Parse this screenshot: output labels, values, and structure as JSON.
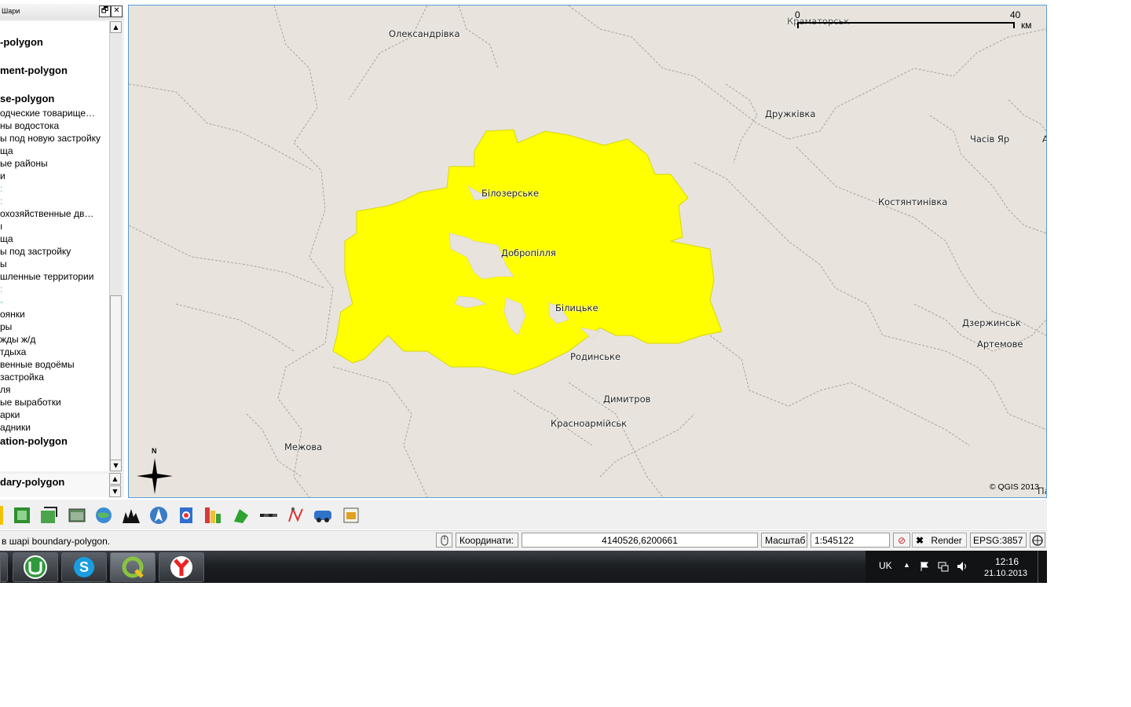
{
  "layers_panel": {
    "title": "Шари",
    "restore_glyph": "🗗",
    "close_glyph": "✕",
    "scroll_up": "▲",
    "scroll_down": "▼",
    "items": [
      {
        "label": "-polygon",
        "bold": true
      },
      {
        "label": "ment-polygon",
        "bold": true
      },
      {
        "label": "se-polygon",
        "bold": true
      },
      {
        "label": "одческие товарище…"
      },
      {
        "label": "ны водостока"
      },
      {
        "label": "ы под новую застройку"
      },
      {
        "label": "ща"
      },
      {
        "label": "ые районы"
      },
      {
        "label": "и"
      },
      {
        "label": ":",
        "cyan": true
      },
      {
        "label": ":",
        "cyan": true
      },
      {
        "label": "охозяйственные дв…"
      },
      {
        "label": "ı"
      },
      {
        "label": "ща"
      },
      {
        "label": "ы под застройку"
      },
      {
        "label": "ы"
      },
      {
        "label": "шленные территории"
      },
      {
        "label": ":",
        "cyan": true
      },
      {
        "label": "-",
        "cyan": true
      },
      {
        "label": "оянки"
      },
      {
        "label": "ры"
      },
      {
        "label": "жды ж/д"
      },
      {
        "label": "тдыха"
      },
      {
        "label": "венные водоёмы"
      },
      {
        "label": "застройка"
      },
      {
        "label": "ля"
      },
      {
        "label": "ые выработки"
      },
      {
        "label": "арки"
      },
      {
        "label": "адники"
      },
      {
        "label": "ation-polygon",
        "bold": true
      }
    ],
    "bottom_item": "dary-polygon"
  },
  "map": {
    "background_color": "#e8e4dd",
    "highlight_color": "#ffff00",
    "cities": [
      {
        "name": "Олександрівка"
      },
      {
        "name": "Дружківка"
      },
      {
        "name": "Часів Яр"
      },
      {
        "name": "Костянтинівка"
      },
      {
        "name": "Білозерське"
      },
      {
        "name": "Добропілля"
      },
      {
        "name": "Білицьке"
      },
      {
        "name": "Родинське"
      },
      {
        "name": "Димитров"
      },
      {
        "name": "Красноармійськ"
      },
      {
        "name": "Межова"
      },
      {
        "name": "Дзержинськ"
      },
      {
        "name": "Артемове"
      },
      {
        "name": "Краматорськ"
      }
    ],
    "edge_labels": {
      "right_a": "А",
      "right_pa": "Па"
    },
    "scalebar": {
      "start": "0",
      "end": "40",
      "unit": "км"
    },
    "north_label": "N",
    "copyright": "© QGIS 2013"
  },
  "toolbar": {
    "tools": [
      "python-plugin-icon",
      "georeferencer-icon",
      "vector-digitize-icon",
      "raster-calc-icon",
      "globe-icon",
      "terrain-icon",
      "north-arrow-icon",
      "copyright-plugin-icon",
      "heatmap-icon",
      "gps-tools-icon",
      "scale-tool-icon",
      "route-icon",
      "spatial-query-icon",
      "image-icon"
    ]
  },
  "status_bar": {
    "message": "в шарі boundary-polygon.",
    "coords_label": "Координати:",
    "coords_value": "4140526,6200661",
    "scale_label": "Масштаб",
    "scale_value": "1:545122",
    "render_label": "Render",
    "crs": "EPSG:3857"
  },
  "taskbar": {
    "language": "UK",
    "time": "12:16",
    "date": "21.10.2013",
    "apps": [
      "utorrent-icon",
      "skype-icon",
      "qgis-icon",
      "yandex-browser-icon"
    ]
  }
}
